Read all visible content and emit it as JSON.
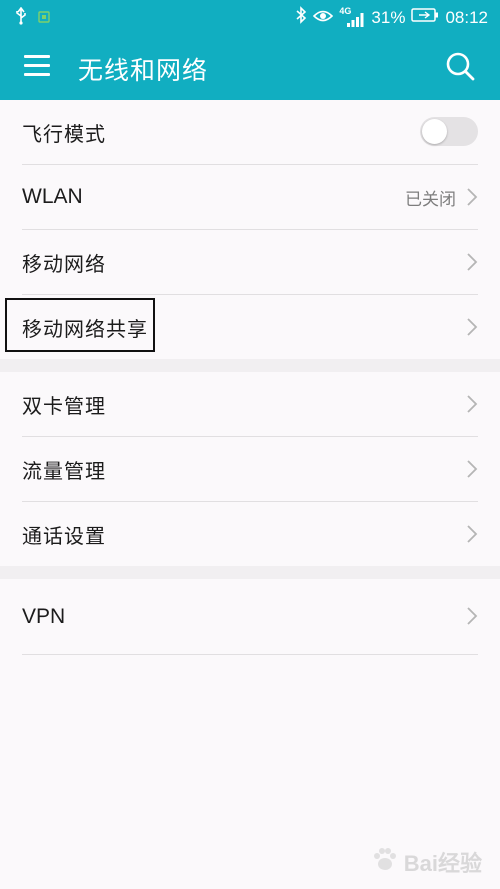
{
  "status_bar": {
    "network_label": "4G",
    "battery_percent": "31%",
    "time": "08:12",
    "icons": [
      "usb-icon",
      "notification-icon",
      "bluetooth-icon",
      "eye-icon",
      "signal-icon",
      "battery-icon"
    ]
  },
  "header": {
    "title": "无线和网络",
    "menu_icon": "hamburger-menu-icon",
    "search_icon": "search-icon"
  },
  "settings": {
    "airplane_mode": {
      "label": "飞行模式",
      "enabled": false
    },
    "wlan": {
      "label": "WLAN",
      "value": "已关闭"
    },
    "mobile_network": {
      "label": "移动网络"
    },
    "tethering": {
      "label": "移动网络共享"
    },
    "dual_sim": {
      "label": "双卡管理"
    },
    "data_usage": {
      "label": "流量管理"
    },
    "call_settings": {
      "label": "通话设置"
    },
    "vpn": {
      "label": "VPN"
    }
  },
  "watermark": {
    "text": "Bai经验"
  },
  "colors": {
    "accent": "#11aec1",
    "background": "#fbf9fb",
    "section_gap": "#f1eff1",
    "divider": "#e1dfe1",
    "secondary_text": "#7d7d7d"
  }
}
